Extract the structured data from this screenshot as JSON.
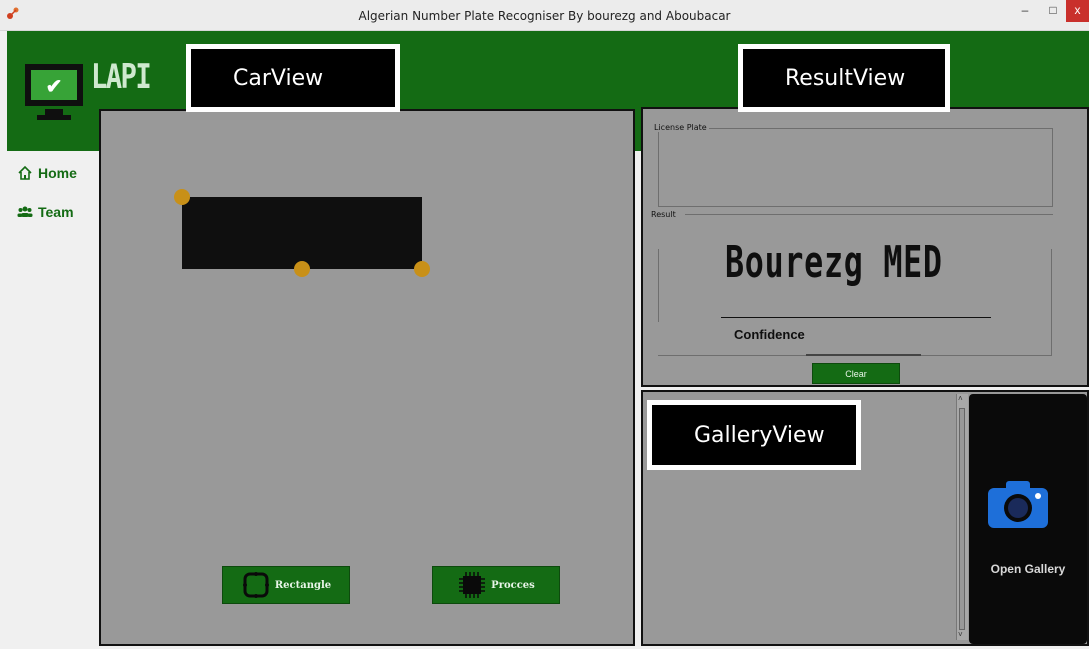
{
  "window": {
    "title": "Algerian Number Plate Recogniser By bourezg and Aboubacar",
    "min_label": "–",
    "max_label": "□",
    "close_label": "x"
  },
  "header": {
    "logo_text": "LAPI"
  },
  "sidebar": {
    "items": [
      {
        "label": "Home",
        "icon": "home-icon"
      },
      {
        "label": "Team",
        "icon": "team-icon"
      }
    ]
  },
  "annotations": {
    "carview": "CarView",
    "resultview": "ResultView",
    "galleryview": "GalleryView"
  },
  "carview": {
    "rectangle_label": "Rectangle",
    "process_label": "Procces"
  },
  "resultview": {
    "license_plate_label": "License Plate",
    "result_label": "Result",
    "result_value": "Bourezg MED",
    "confidence_label": "Confidence",
    "clear_label": "Clear"
  },
  "galleryview": {
    "open_gallery_label": "Open Gallery"
  },
  "colors": {
    "brand_green": "#146b14",
    "panel_gray": "#999999",
    "handle_gold": "#c89018",
    "camera_blue": "#1e6fd9"
  }
}
